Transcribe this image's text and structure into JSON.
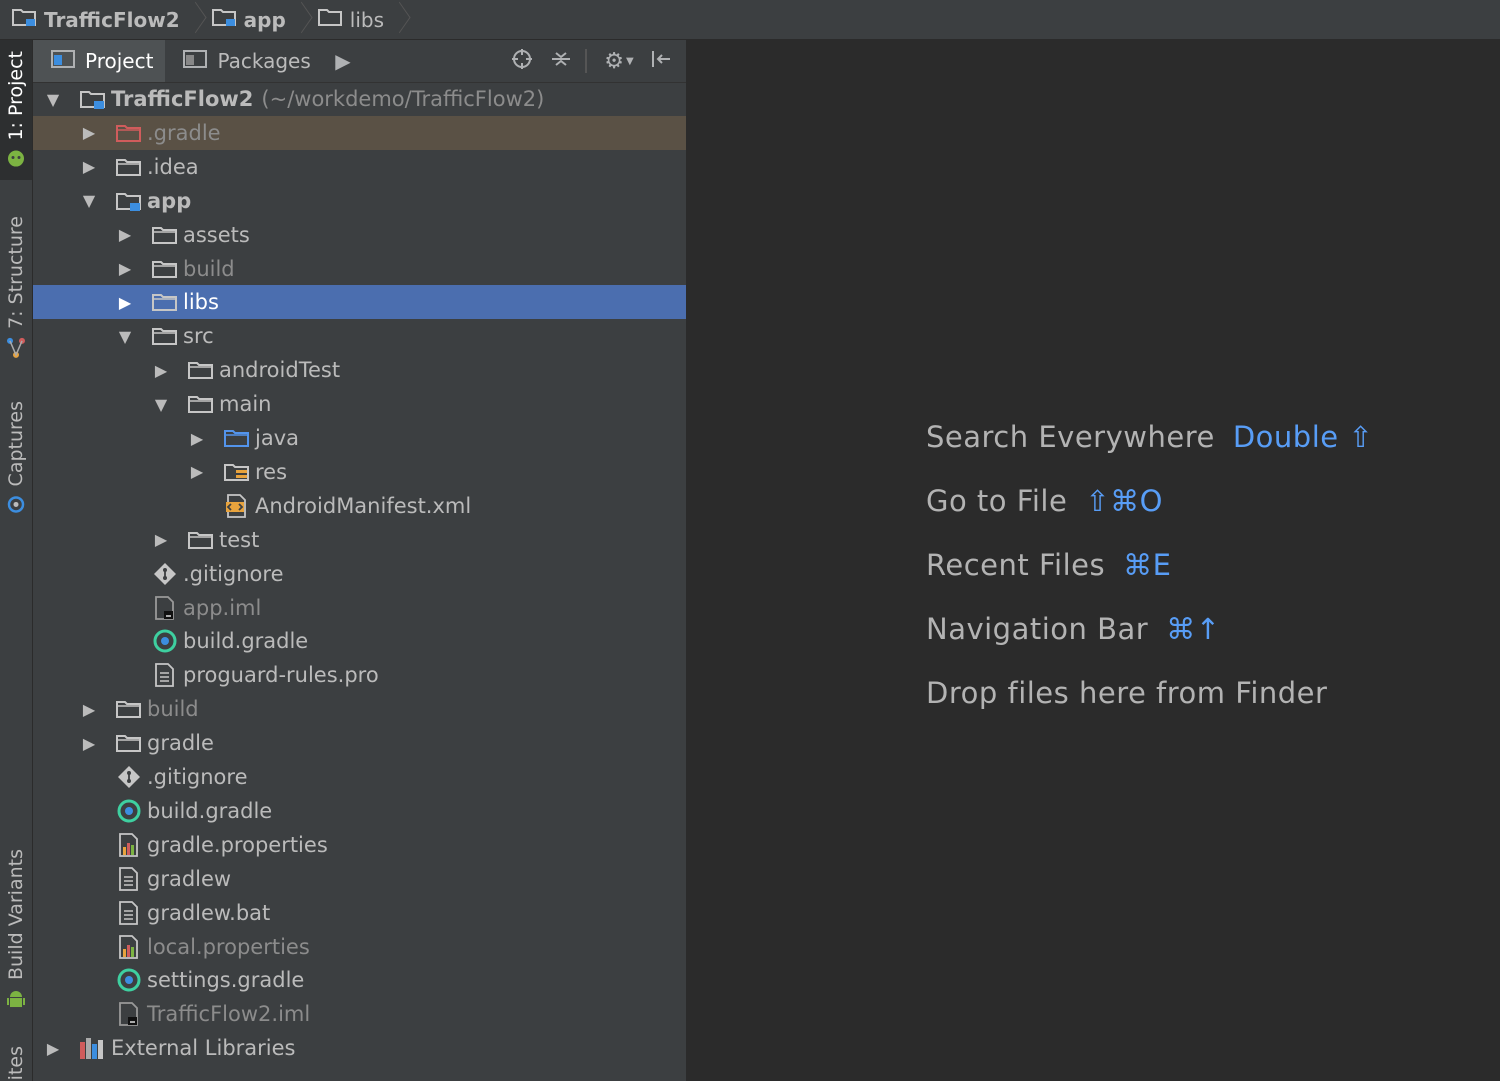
{
  "breadcrumb": [
    "TrafficFlow2",
    "app",
    "libs"
  ],
  "tool_strip": {
    "tabs": [
      {
        "label": "1: Project",
        "icon": "android-head-icon",
        "active": true
      },
      {
        "label": "7: Structure",
        "icon": "structure-icon",
        "active": false
      },
      {
        "label": "Captures",
        "icon": "captures-icon",
        "active": false
      },
      {
        "label": "Build Variants",
        "icon": "android-icon",
        "active": false
      },
      {
        "label": "ites",
        "icon": "",
        "active": false
      }
    ]
  },
  "panel": {
    "tabs": [
      {
        "label": "Project",
        "active": true
      },
      {
        "label": "Packages",
        "active": false
      }
    ],
    "tree": [
      {
        "label": "TrafficFlow2",
        "hint": "(~/workdemo/TrafficFlow2)",
        "depth": 0,
        "arrow": "down",
        "icon": "module-folder-icon",
        "bold": true
      },
      {
        "label": ".gradle",
        "depth": 1,
        "arrow": "right",
        "icon": "excluded-folder-icon",
        "dim": true,
        "highlight": true
      },
      {
        "label": ".idea",
        "depth": 1,
        "arrow": "right",
        "icon": "folder-icon"
      },
      {
        "label": "app",
        "depth": 1,
        "arrow": "down",
        "icon": "module-folder-icon",
        "bold": true
      },
      {
        "label": "assets",
        "depth": 2,
        "arrow": "right",
        "icon": "folder-icon"
      },
      {
        "label": "build",
        "depth": 2,
        "arrow": "right",
        "icon": "folder-icon",
        "dim": true
      },
      {
        "label": "libs",
        "depth": 2,
        "arrow": "right",
        "icon": "folder-icon",
        "selected": true
      },
      {
        "label": "src",
        "depth": 2,
        "arrow": "down",
        "icon": "folder-icon"
      },
      {
        "label": "androidTest",
        "depth": 3,
        "arrow": "right",
        "icon": "folder-icon"
      },
      {
        "label": "main",
        "depth": 3,
        "arrow": "down",
        "icon": "folder-icon"
      },
      {
        "label": "java",
        "depth": 4,
        "arrow": "right",
        "icon": "source-folder-icon"
      },
      {
        "label": "res",
        "depth": 4,
        "arrow": "right",
        "icon": "resource-folder-icon"
      },
      {
        "label": "AndroidManifest.xml",
        "depth": 4,
        "arrow": "none",
        "icon": "xml-file-icon"
      },
      {
        "label": "test",
        "depth": 3,
        "arrow": "right",
        "icon": "folder-icon"
      },
      {
        "label": ".gitignore",
        "depth": 2,
        "arrow": "none",
        "icon": "git-icon"
      },
      {
        "label": "app.iml",
        "depth": 2,
        "arrow": "none",
        "icon": "iml-file-icon",
        "dim": true
      },
      {
        "label": "build.gradle",
        "depth": 2,
        "arrow": "none",
        "icon": "gradle-icon"
      },
      {
        "label": "proguard-rules.pro",
        "depth": 2,
        "arrow": "none",
        "icon": "text-file-icon"
      },
      {
        "label": "build",
        "depth": 1,
        "arrow": "right",
        "icon": "folder-icon",
        "dim": true
      },
      {
        "label": "gradle",
        "depth": 1,
        "arrow": "right",
        "icon": "folder-icon"
      },
      {
        "label": ".gitignore",
        "depth": 1,
        "arrow": "none",
        "icon": "git-icon"
      },
      {
        "label": "build.gradle",
        "depth": 1,
        "arrow": "none",
        "icon": "gradle-icon"
      },
      {
        "label": "gradle.properties",
        "depth": 1,
        "arrow": "none",
        "icon": "properties-file-icon"
      },
      {
        "label": "gradlew",
        "depth": 1,
        "arrow": "none",
        "icon": "text-file-icon"
      },
      {
        "label": "gradlew.bat",
        "depth": 1,
        "arrow": "none",
        "icon": "text-file-icon"
      },
      {
        "label": "local.properties",
        "depth": 1,
        "arrow": "none",
        "icon": "properties-file-icon",
        "dim": true
      },
      {
        "label": "settings.gradle",
        "depth": 1,
        "arrow": "none",
        "icon": "gradle-icon"
      },
      {
        "label": "TrafficFlow2.iml",
        "depth": 1,
        "arrow": "none",
        "icon": "iml-file-icon",
        "dim": true
      },
      {
        "label": "External Libraries",
        "depth": 0,
        "arrow": "right",
        "icon": "library-icon"
      }
    ]
  },
  "editor": {
    "hints": [
      {
        "text": "Search Everywhere",
        "key": "Double ⇧"
      },
      {
        "text": "Go to File",
        "key": "⇧⌘O"
      },
      {
        "text": "Recent Files",
        "key": "⌘E"
      },
      {
        "text": "Navigation Bar",
        "key": "⌘↑"
      },
      {
        "text": "Drop files here from Finder",
        "key": ""
      }
    ]
  },
  "colors": {
    "selection": "#4b6eaf",
    "shortcut": "#589df6",
    "folder": "#c6c6c6",
    "excluded": "#d05c5c"
  }
}
